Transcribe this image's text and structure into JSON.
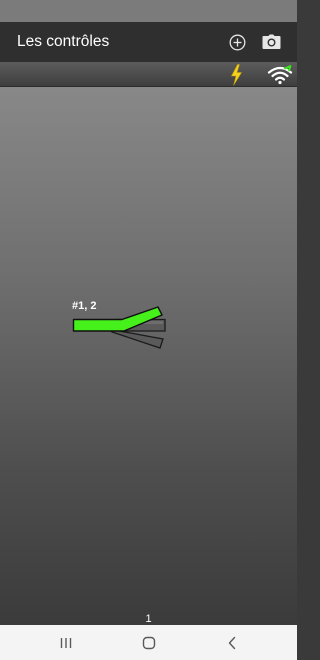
{
  "header": {
    "title": "Les contrôles",
    "add_icon": "plus-circle-icon",
    "camera_icon": "camera-icon"
  },
  "toolbar": {
    "power_icon": "lightning-bolt-icon",
    "wifi_icon": "wifi-icon",
    "power_color": "#f2d21e",
    "wifi_color": "#ffffff",
    "wifi_accent_color": "#39e81b"
  },
  "layout_canvas": {
    "turnout": {
      "label": "#1, 2",
      "active_branch_color": "#46f01a",
      "inactive_branch_color": "#5a5a5a"
    },
    "page_number": "1"
  },
  "nav_bar": {
    "recent_icon": "recent-apps-icon",
    "home_icon": "home-icon",
    "back_icon": "back-icon"
  }
}
